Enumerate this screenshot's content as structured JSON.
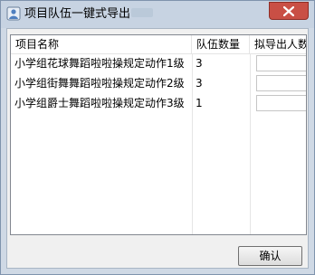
{
  "window": {
    "title": "项目队伍一键式导出",
    "close_icon": "close-icon",
    "app_icon": "app-icon"
  },
  "table": {
    "columns": [
      "项目名称",
      "队伍数量",
      "拟导出人数"
    ],
    "rows": [
      {
        "name": "小学组花球舞蹈啦啦操规定动作1级",
        "count": "3",
        "export": ""
      },
      {
        "name": "小学组街舞舞蹈啦啦操规定动作2级",
        "count": "3",
        "export": ""
      },
      {
        "name": "小学组爵士舞蹈啦啦操规定动作3级",
        "count": "1",
        "export": ""
      }
    ]
  },
  "buttons": {
    "ok_label": "确认"
  }
}
